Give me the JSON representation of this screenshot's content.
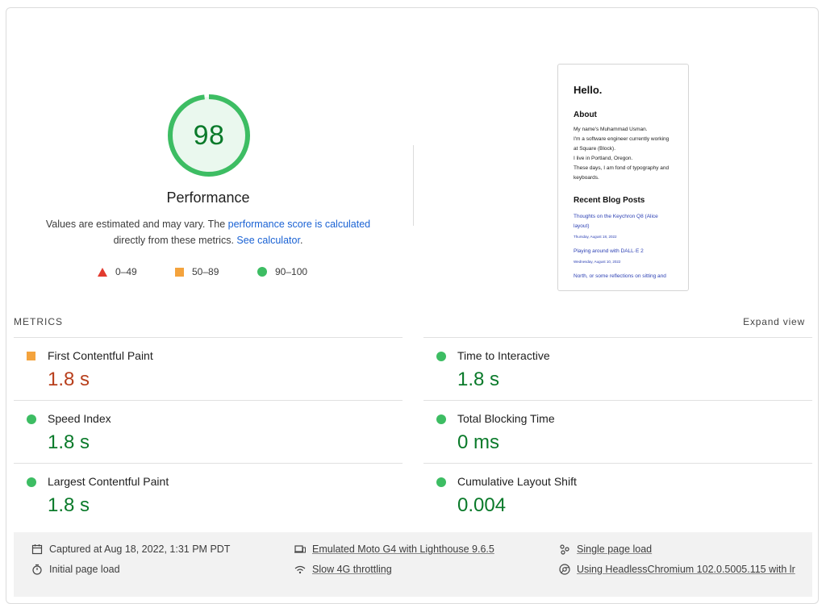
{
  "score": {
    "value": "98",
    "fraction": 0.98,
    "title": "Performance"
  },
  "description": {
    "prefix": "Values are estimated and may vary. The ",
    "link1": "performance score is calculated",
    "middle": " directly from these metrics. ",
    "link2": "See calculator",
    "suffix": "."
  },
  "legend": [
    {
      "shape": "triangle",
      "range": "0–49",
      "color": "#e23b2f"
    },
    {
      "shape": "square",
      "range": "50–89",
      "color": "#f4a33d"
    },
    {
      "shape": "circle",
      "range": "90–100",
      "color": "#3dbd63"
    }
  ],
  "screenshot": {
    "heading": "Hello.",
    "about_title": "About",
    "about_lines": [
      "My name's Muhammad Usman.",
      "I'm a software engineer currently working",
      "at Square (Block).",
      "I live in Portland, Oregon.",
      "These days, I am fond of typography and",
      "keyboards."
    ],
    "posts_title": "Recent Blog Posts",
    "posts": [
      {
        "title_line1": "Thoughts on the Keychron Q8 (Alice",
        "title_line2": "layout)",
        "date": "Thursday, August 18, 2022"
      },
      {
        "title_line1": "Playing around with DALL·E 2",
        "title_line2": "",
        "date": "Wednesday, August 10, 2022"
      },
      {
        "title_line1": "North, or some reflections on sitting and",
        "title_line2": "",
        "date": ""
      }
    ]
  },
  "metrics": {
    "label": "METRICS",
    "expand": "Expand view",
    "items": [
      {
        "name": "First Contentful Paint",
        "value": "1.8 s",
        "status": "orange"
      },
      {
        "name": "Time to Interactive",
        "value": "1.8 s",
        "status": "green"
      },
      {
        "name": "Speed Index",
        "value": "1.8 s",
        "status": "green"
      },
      {
        "name": "Total Blocking Time",
        "value": "0 ms",
        "status": "green"
      },
      {
        "name": "Largest Contentful Paint",
        "value": "1.8 s",
        "status": "green"
      },
      {
        "name": "Cumulative Layout Shift",
        "value": "0.004",
        "status": "green"
      }
    ]
  },
  "footer": {
    "captured": "Captured at Aug 18, 2022, 1:31 PM PDT",
    "initial": "Initial page load",
    "device": "Emulated Moto G4 with Lighthouse 9.6.5",
    "throttling": "Slow 4G throttling",
    "single": "Single page load",
    "browser": "Using HeadlessChromium 102.0.5005.115 with lr"
  },
  "colors": {
    "good": "#3dbd63",
    "good_text": "#0a7a2a",
    "average": "#f4a33d",
    "average_text": "#b83f1c",
    "poor": "#e23b2f",
    "link": "#1a62d4"
  }
}
